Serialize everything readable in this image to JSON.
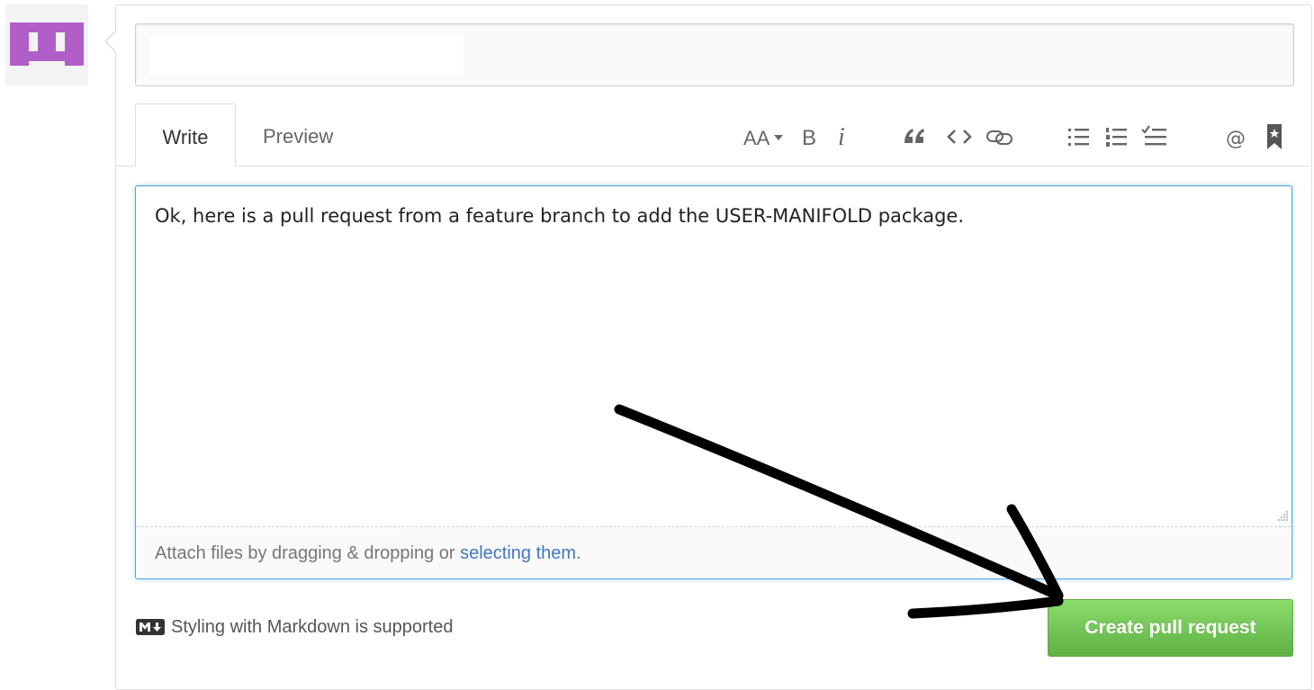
{
  "user": {
    "avatar_color": "#b25ec9"
  },
  "pull_request_form": {
    "title_value": "",
    "tabs": {
      "write_label": "Write",
      "preview_label": "Preview"
    },
    "toolbar": [
      {
        "icon": "header-icon"
      },
      {
        "icon": "bold-icon"
      },
      {
        "icon": "italic-icon"
      },
      {
        "icon": "quote-icon"
      },
      {
        "icon": "code-icon"
      },
      {
        "icon": "link-icon"
      },
      {
        "icon": "unordered-list-icon"
      },
      {
        "icon": "ordered-list-icon"
      },
      {
        "icon": "task-list-icon"
      },
      {
        "icon": "mention-icon"
      },
      {
        "icon": "saved-reply-icon"
      }
    ],
    "body_value": "Ok, here is a pull request from a feature branch to add the USER-MANIFOLD package.",
    "attach": {
      "prefix": "Attach files by dragging & dropping or ",
      "link": "selecting them",
      "suffix": "."
    },
    "markdown_hint": "Styling with Markdown is supported",
    "submit_label": "Create pull request",
    "colors": {
      "focus_border": "#51a7e8",
      "link": "#4078c0",
      "button_green": "#60b044"
    }
  }
}
